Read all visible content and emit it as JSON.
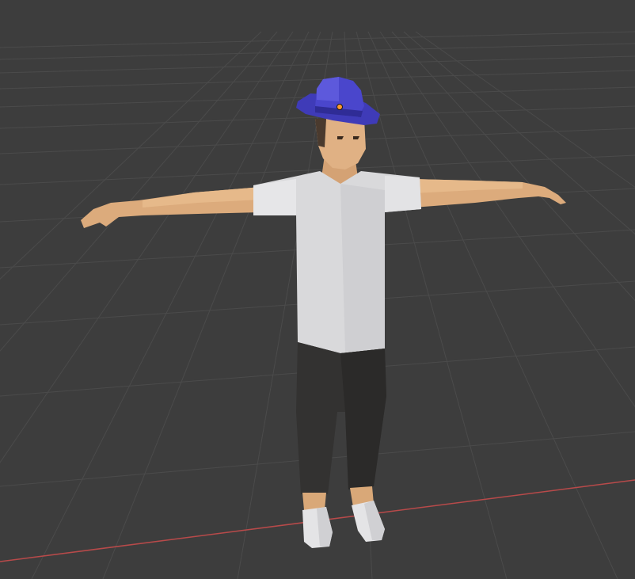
{
  "viewport": {
    "name": "3D Viewport",
    "background_color": "#3d3d3d",
    "grid_color": "#4a4a4a",
    "x_axis_color": "#c05050"
  },
  "scene": {
    "selected_object": "Hat",
    "hat_color": "#4a46cc",
    "origin_dot_color": "#ff9a2e",
    "shirt_color": "#d9d9db",
    "pants_color": "#333231",
    "skin_color": "#e0b184",
    "shoe_color": "#e4e4e6"
  }
}
